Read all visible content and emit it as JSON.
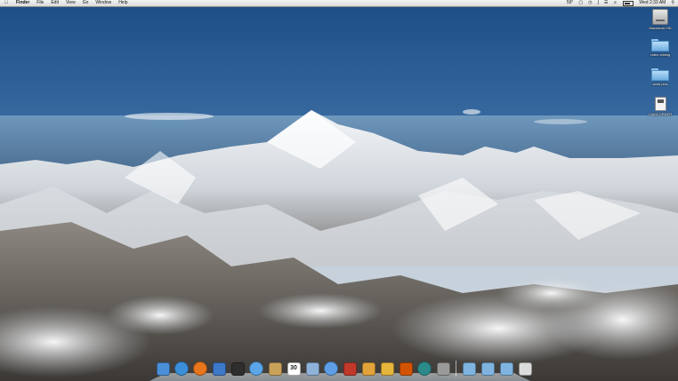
{
  "menubar": {
    "apple_icon": "apple-icon",
    "items": [
      "Finder",
      "File",
      "Edit",
      "View",
      "Go",
      "Window",
      "Help"
    ],
    "status": {
      "temperature": "59°",
      "datetime": "Wed 2:33 AM"
    }
  },
  "desktop_icons": [
    {
      "label": "Macintosh HD",
      "icon": "hard-drive-icon"
    },
    {
      "label": "video editing",
      "icon": "folder-icon"
    },
    {
      "label": "sand pics",
      "icon": "folder-icon"
    },
    {
      "label": "CAMCORDER",
      "icon": "sd-card-icon"
    }
  ],
  "dock": {
    "apps": [
      {
        "name": "finder",
        "icon": "finder-icon",
        "color": "#4a90d9"
      },
      {
        "name": "safari",
        "icon": "safari-icon",
        "color": "#3b8fd8"
      },
      {
        "name": "firefox",
        "icon": "firefox-icon",
        "color": "#e8761c"
      },
      {
        "name": "preview",
        "icon": "preview-icon",
        "color": "#3d78c9"
      },
      {
        "name": "photo-booth",
        "icon": "photo-booth-icon",
        "color": "#2e2e2e"
      },
      {
        "name": "ichat",
        "icon": "ichat-icon",
        "color": "#5aa6e8"
      },
      {
        "name": "address-book",
        "icon": "address-book-icon",
        "color": "#c9a25a"
      },
      {
        "name": "ical",
        "icon": "ical-icon",
        "color": "#ffffff",
        "text": "30"
      },
      {
        "name": "iphoto",
        "icon": "iphoto-icon",
        "color": "#8fb2d9"
      },
      {
        "name": "itunes",
        "icon": "itunes-icon",
        "color": "#5d9ee6"
      },
      {
        "name": "photo-app",
        "icon": "photo-app-icon",
        "color": "#c0392b"
      },
      {
        "name": "imovie",
        "icon": "imovie-icon",
        "color": "#e2a33a"
      },
      {
        "name": "garageband",
        "icon": "garageband-icon",
        "color": "#e5b53c"
      },
      {
        "name": "guitar-app",
        "icon": "guitar-icon",
        "color": "#d35400"
      },
      {
        "name": "time-machine",
        "icon": "time-machine-icon",
        "color": "#2d8a8a"
      },
      {
        "name": "system-preferences",
        "icon": "gear-icon",
        "color": "#9a9a9a"
      }
    ],
    "stacks": [
      {
        "name": "applications-stack",
        "icon": "folder-icon",
        "color": "#7fb4e0"
      },
      {
        "name": "documents-stack",
        "icon": "folder-icon",
        "color": "#7fb4e0"
      },
      {
        "name": "downloads-stack",
        "icon": "folder-icon",
        "color": "#7fb4e0"
      },
      {
        "name": "trash",
        "icon": "trash-icon",
        "color": "#dcdcdc"
      }
    ]
  }
}
